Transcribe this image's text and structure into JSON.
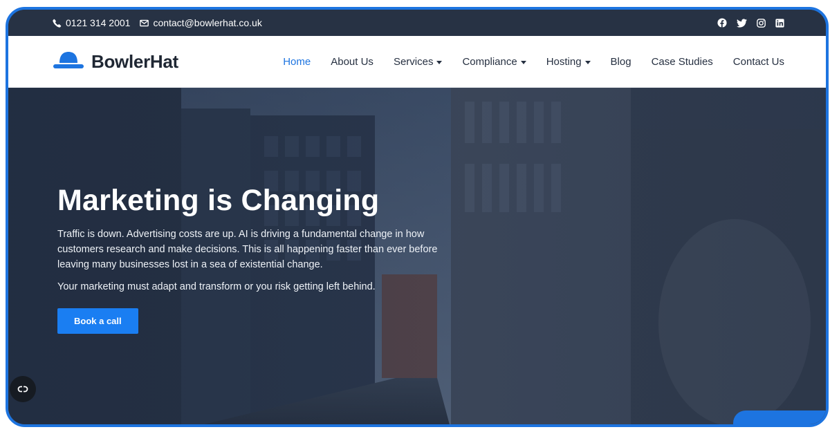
{
  "topbar": {
    "phone": "0121 314 2001",
    "email": "contact@bowlerhat.co.uk",
    "social_icons": [
      "facebook-icon",
      "twitter-icon",
      "instagram-icon",
      "linkedin-icon"
    ]
  },
  "brand": {
    "name": "BowlerHat",
    "accent": "#1d74e0"
  },
  "nav": {
    "items": [
      {
        "label": "Home",
        "active": true,
        "dropdown": false
      },
      {
        "label": "About Us",
        "active": false,
        "dropdown": false
      },
      {
        "label": "Services",
        "active": false,
        "dropdown": true
      },
      {
        "label": "Compliance",
        "active": false,
        "dropdown": true
      },
      {
        "label": "Hosting",
        "active": false,
        "dropdown": true
      },
      {
        "label": "Blog",
        "active": false,
        "dropdown": false
      },
      {
        "label": "Case Studies",
        "active": false,
        "dropdown": false
      },
      {
        "label": "Contact Us",
        "active": false,
        "dropdown": false
      }
    ]
  },
  "hero": {
    "title": "Marketing is Changing",
    "paragraph1": "Traffic is down. Advertising costs are up. AI is driving a fundamental change in how customers research and make decisions. This is all happening faster than ever before leaving many businesses lost in a sea of existential change.",
    "paragraph2": "Your marketing must adapt and transform or you risk getting left behind.",
    "cta_label": "Book a call"
  },
  "widgets": {
    "cookie_icon": "cookie-settings-icon",
    "chat_icon": "chat-launcher-icon"
  }
}
